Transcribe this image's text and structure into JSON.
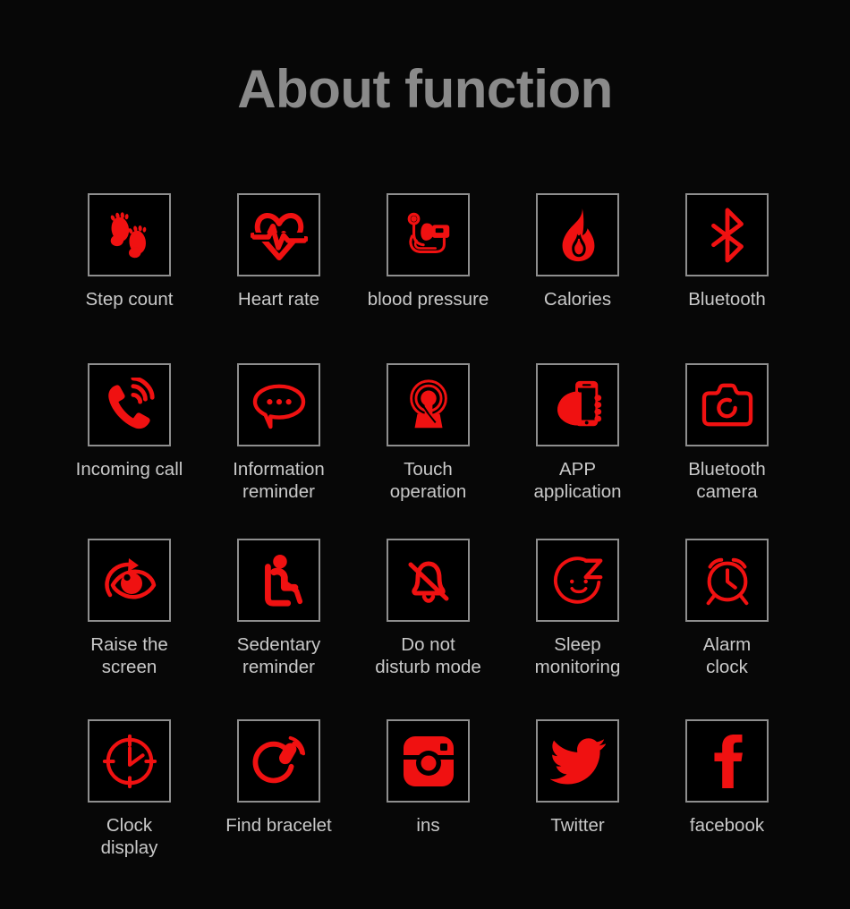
{
  "page": {
    "title": "About function",
    "background_color": "#070707",
    "title_color": "#8a8a8a",
    "label_color": "#c9c9c9",
    "icon_color": "#f01111",
    "box_border_color": "#8e8e8e"
  },
  "grid": {
    "columns": 5,
    "rows": 4,
    "items": [
      {
        "label": "Step count",
        "icon": "footprints-icon"
      },
      {
        "label": "Heart rate",
        "icon": "heart-pulse-icon"
      },
      {
        "label": "blood pressure",
        "icon": "blood-pressure-monitor-icon"
      },
      {
        "label": "Calories",
        "icon": "flame-icon"
      },
      {
        "label": "Bluetooth",
        "icon": "bluetooth-icon"
      },
      {
        "label": "Incoming call",
        "icon": "ringing-phone-icon"
      },
      {
        "label": "Information\nreminder",
        "icon": "speech-bubble-icon"
      },
      {
        "label": "Touch\noperation",
        "icon": "touch-finger-icon"
      },
      {
        "label": "APP\napplication",
        "icon": "hand-holding-phone-icon"
      },
      {
        "label": "Bluetooth\ncamera",
        "icon": "camera-icon"
      },
      {
        "label": "Raise the\nscreen",
        "icon": "raise-wrist-eye-icon"
      },
      {
        "label": "Sedentary\nreminder",
        "icon": "seated-person-icon"
      },
      {
        "label": "Do not\ndisturb mode",
        "icon": "bell-slash-icon"
      },
      {
        "label": "Sleep\nmonitoring",
        "icon": "sleeping-face-icon"
      },
      {
        "label": "Alarm\nclock",
        "icon": "alarm-clock-icon"
      },
      {
        "label": "Clock\ndisplay",
        "icon": "clock-face-icon"
      },
      {
        "label": "Find bracelet",
        "icon": "vibrating-bracelet-icon"
      },
      {
        "label": "ins",
        "icon": "instagram-icon"
      },
      {
        "label": "Twitter",
        "icon": "twitter-bird-icon"
      },
      {
        "label": "facebook",
        "icon": "facebook-f-icon"
      }
    ]
  }
}
